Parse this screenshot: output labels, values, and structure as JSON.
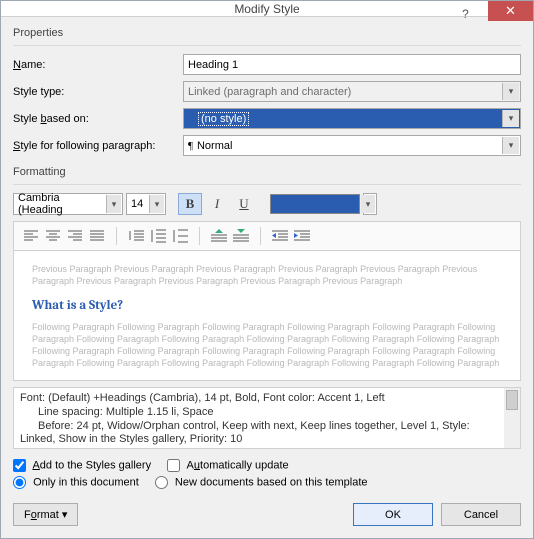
{
  "title": "Modify Style",
  "group_properties": "Properties",
  "group_formatting": "Formatting",
  "labels": {
    "name": "Name:",
    "style_type": "Style type:",
    "based_on": "Style based on:",
    "following": "Style for following paragraph:"
  },
  "values": {
    "name": "Heading 1",
    "style_type": "Linked (paragraph and character)",
    "based_on": "(no style)",
    "following": "Normal"
  },
  "font": {
    "family": "Cambria (Heading",
    "size": "14"
  },
  "preview": {
    "prev": "Previous Paragraph Previous Paragraph Previous Paragraph Previous Paragraph Previous Paragraph Previous Paragraph Previous Paragraph Previous Paragraph Previous Paragraph Previous Paragraph",
    "sample": "What is a Style?",
    "foll": "Following Paragraph Following Paragraph Following Paragraph Following Paragraph Following Paragraph Following Paragraph Following Paragraph Following Paragraph Following Paragraph Following Paragraph Following Paragraph Following Paragraph Following Paragraph Following Paragraph Following Paragraph Following Paragraph Following Paragraph Following Paragraph Following Paragraph Following Paragraph Following Paragraph Following Paragraph"
  },
  "description": {
    "l1": "Font: (Default) +Headings (Cambria), 14 pt, Bold, Font color: Accent 1, Left",
    "l2": "Line spacing:  Multiple 1.15 li, Space",
    "l3": "Before:  24 pt, Widow/Orphan control, Keep with next, Keep lines together, Level 1, Style:",
    "l4": "Linked, Show in the Styles gallery, Priority: 10"
  },
  "checks": {
    "add_gallery": "Add to the Styles gallery",
    "auto_update": "Automatically update",
    "only_doc": "Only in this document",
    "new_docs": "New documents based on this template"
  },
  "buttons": {
    "format": "Format",
    "ok": "OK",
    "cancel": "Cancel"
  }
}
